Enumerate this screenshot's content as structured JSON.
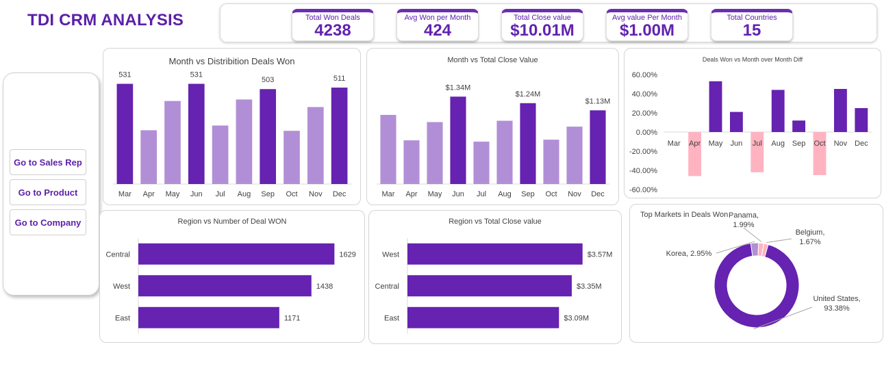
{
  "page_title": "TDI CRM ANALYSIS",
  "kpis": [
    {
      "label": "Total Won Deals",
      "value": "4238"
    },
    {
      "label": "Avg Won per Month",
      "value": "424"
    },
    {
      "label": "Total Close value",
      "value": "$10.01M"
    },
    {
      "label": "Avg value Per Month",
      "value": "$1.00M"
    },
    {
      "label": "Total Countries",
      "value": "15"
    }
  ],
  "nav": {
    "sales_rep": "Go to Sales Rep",
    "product": "Go to Product",
    "company": "Go to Company"
  },
  "colors": {
    "dark": "#6622b0",
    "light": "#b18fd6",
    "pink": "#ffb3c1",
    "accent": "#5b1fa8"
  },
  "chart_data": [
    {
      "id": "deals_won",
      "type": "bar",
      "title": "Month vs Distribition Deals Won",
      "categories": [
        "Mar",
        "Apr",
        "May",
        "Jun",
        "Jul",
        "Aug",
        "Sep",
        "Oct",
        "Nov",
        "Dec"
      ],
      "values": [
        531,
        285,
        440,
        531,
        310,
        448,
        503,
        282,
        408,
        511
      ],
      "highlight": [
        true,
        false,
        false,
        true,
        false,
        false,
        true,
        false,
        false,
        true
      ],
      "data_labels": [
        "531",
        "",
        "",
        "531",
        "",
        "",
        "503",
        "",
        "",
        "511"
      ],
      "ylim": [
        0,
        580
      ]
    },
    {
      "id": "close_value",
      "type": "bar",
      "title": "Month vs Total Close Value",
      "categories": [
        "Mar",
        "Apr",
        "May",
        "Jun",
        "Jul",
        "Aug",
        "Sep",
        "Oct",
        "Nov",
        "Dec"
      ],
      "values": [
        1.06,
        0.67,
        0.95,
        1.34,
        0.65,
        0.97,
        1.24,
        0.68,
        0.88,
        1.13
      ],
      "highlight": [
        false,
        false,
        false,
        true,
        false,
        false,
        true,
        false,
        false,
        true
      ],
      "data_labels": [
        "",
        "",
        "",
        "$1.34M",
        "",
        "",
        "$1.24M",
        "",
        "",
        "$1.13M"
      ],
      "ylim": [
        0,
        1.5
      ]
    },
    {
      "id": "mom_diff",
      "type": "bar",
      "title": "Deals Won vs Month over Month Diff",
      "categories": [
        "Mar",
        "Apr",
        "May",
        "Jun",
        "Jul",
        "Aug",
        "Sep",
        "Oct",
        "Nov",
        "Dec"
      ],
      "values": [
        null,
        -46,
        53,
        21,
        -42,
        44,
        12,
        -45,
        45,
        25
      ],
      "yticks": [
        "60.00%",
        "40.00%",
        "20.00%",
        "0.00%",
        "-20.00%",
        "-40.00%",
        "-60.00%"
      ],
      "ylim": [
        -60,
        60
      ]
    },
    {
      "id": "region_deals",
      "type": "bar",
      "orientation": "horizontal",
      "title": "Region vs Number of Deal WON",
      "categories": [
        "Central",
        "West",
        "East"
      ],
      "values": [
        1629,
        1438,
        1171
      ],
      "data_labels": [
        "1629",
        "1438",
        "1171"
      ],
      "xlim": [
        0,
        1900
      ]
    },
    {
      "id": "region_value",
      "type": "bar",
      "orientation": "horizontal",
      "title": "Region vs Total Close value",
      "categories": [
        "West",
        "Central",
        "East"
      ],
      "values": [
        3.57,
        3.35,
        3.09
      ],
      "data_labels": [
        "$3.57M",
        "$3.35M",
        "$3.09M"
      ],
      "xlim": [
        0,
        4.3
      ]
    },
    {
      "id": "top_markets",
      "type": "pie",
      "title": "Top Markets in Deals Won",
      "slices": [
        {
          "name": "United States",
          "pct": "93.38%",
          "value": 93.38
        },
        {
          "name": "Korea",
          "pct": "2.95%",
          "value": 2.95
        },
        {
          "name": "Panama",
          "pct": "1.99%",
          "value": 1.99
        },
        {
          "name": "Belgium",
          "pct": "1.67%",
          "value": 1.67
        }
      ]
    }
  ]
}
